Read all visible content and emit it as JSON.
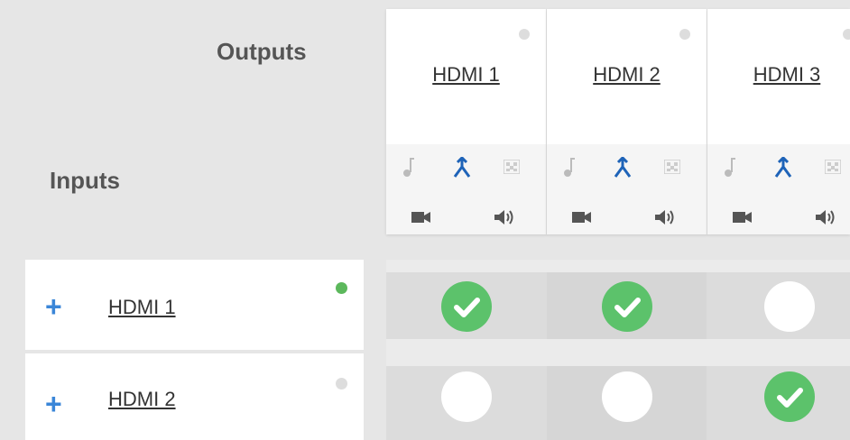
{
  "headers": {
    "outputs": "Outputs",
    "inputs": "Inputs"
  },
  "outputs": [
    {
      "name": "HDMI 1",
      "status": "inactive"
    },
    {
      "name": "HDMI 2",
      "status": "inactive"
    },
    {
      "name": "HDMI 3",
      "status": "inactive"
    }
  ],
  "inputs": [
    {
      "name": "HDMI 1",
      "status": "active"
    },
    {
      "name": "HDMI 2",
      "status": "inactive"
    }
  ],
  "routing": [
    [
      true,
      true,
      false
    ],
    [
      false,
      false,
      true
    ]
  ],
  "icons": {
    "add": "+",
    "output_row1": [
      "music-note-icon",
      "merge-arrows-icon",
      "pattern-grid-icon"
    ],
    "output_row2": [
      "video-camera-icon",
      "speaker-icon"
    ]
  },
  "colors": {
    "active_dot": "#5cb85c",
    "inactive_dot": "#dddddd",
    "accent_blue": "#1e63b8",
    "check_green": "#5cc26b"
  }
}
